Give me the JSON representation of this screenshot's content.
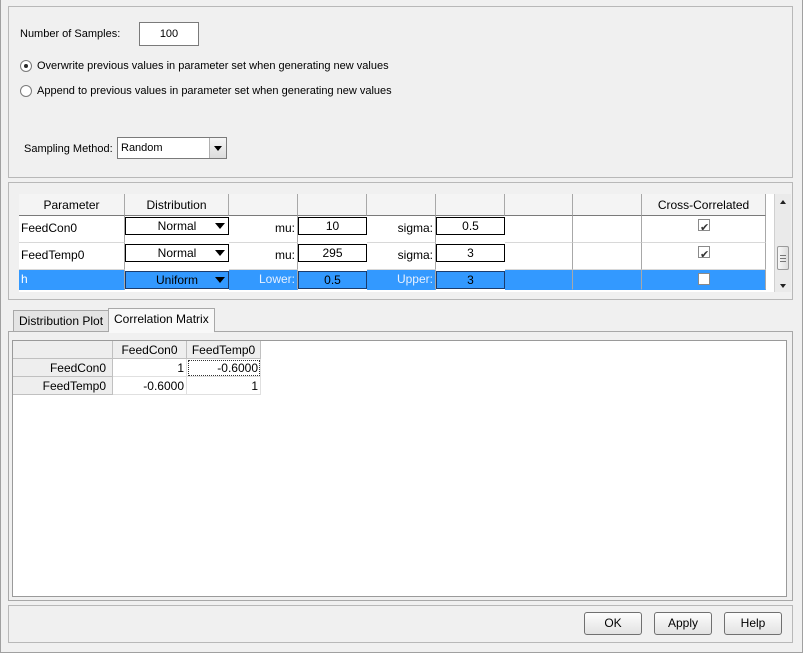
{
  "samples": {
    "label": "Number of Samples:",
    "value": "100"
  },
  "options": {
    "overwrite_label": "Overwrite previous values in parameter set when generating new values",
    "append_label": "Append to previous values in parameter set when generating new values",
    "selected": "overwrite"
  },
  "sampling": {
    "label": "Sampling Method:",
    "value": "Random"
  },
  "table": {
    "headers": [
      "Parameter",
      "Distribution",
      "",
      "",
      "",
      "",
      "",
      "",
      "Cross-Correlated"
    ],
    "rows": [
      {
        "parameter": "FeedCon0",
        "distribution": "Normal",
        "p1_label": "mu:",
        "p1_value": "10",
        "p2_label": "sigma:",
        "p2_value": "0.5",
        "cross_correlated": true,
        "selected": false
      },
      {
        "parameter": "FeedTemp0",
        "distribution": "Normal",
        "p1_label": "mu:",
        "p1_value": "295",
        "p2_label": "sigma:",
        "p2_value": "3",
        "cross_correlated": true,
        "selected": false
      },
      {
        "parameter": "h",
        "distribution": "Uniform",
        "p1_label": "Lower:",
        "p1_value": "0.5",
        "p2_label": "Upper:",
        "p2_value": "3",
        "cross_correlated": false,
        "selected": true
      }
    ]
  },
  "tabs": [
    {
      "label": "Distribution Plot",
      "active": false
    },
    {
      "label": "Correlation Matrix",
      "active": true
    }
  ],
  "matrix": {
    "columns": [
      "FeedCon0",
      "FeedTemp0"
    ],
    "rows": [
      {
        "name": "FeedCon0",
        "values": [
          "1",
          "-0.6000"
        ]
      },
      {
        "name": "FeedTemp0",
        "values": [
          "-0.6000",
          "1"
        ]
      }
    ]
  },
  "buttons": {
    "ok": "OK",
    "apply": "Apply",
    "help": "Help"
  },
  "colors": {
    "selection": "#3399ff",
    "window_bg": "#f0f0f0"
  }
}
